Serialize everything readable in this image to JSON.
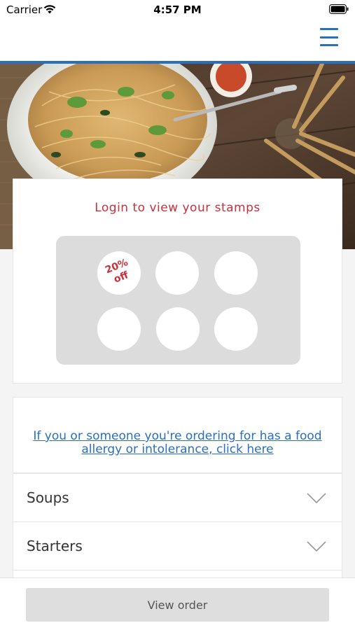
{
  "status_bar": {
    "carrier": "Carrier",
    "time": "4:57 PM",
    "icons": [
      "wifi-icon",
      "battery-icon"
    ]
  },
  "header": {
    "menu_icon": "hamburger-menu-icon",
    "accent_color": "#2a6fbd"
  },
  "hero": {
    "image": "noodle-dish-photo"
  },
  "stamps": {
    "title": "Login to view your stamps",
    "reward_label_line1": "20%",
    "reward_label_line2": "off",
    "stamp_count": 6,
    "title_color": "#c9303b"
  },
  "allergy": {
    "link_text_line1": "If you or someone you're ordering for has a food",
    "link_text_line2": "allergy or intolerance, click here"
  },
  "categories": [
    {
      "label": "Soups"
    },
    {
      "label": "Starters"
    }
  ],
  "footer": {
    "view_order_label": "View order"
  }
}
